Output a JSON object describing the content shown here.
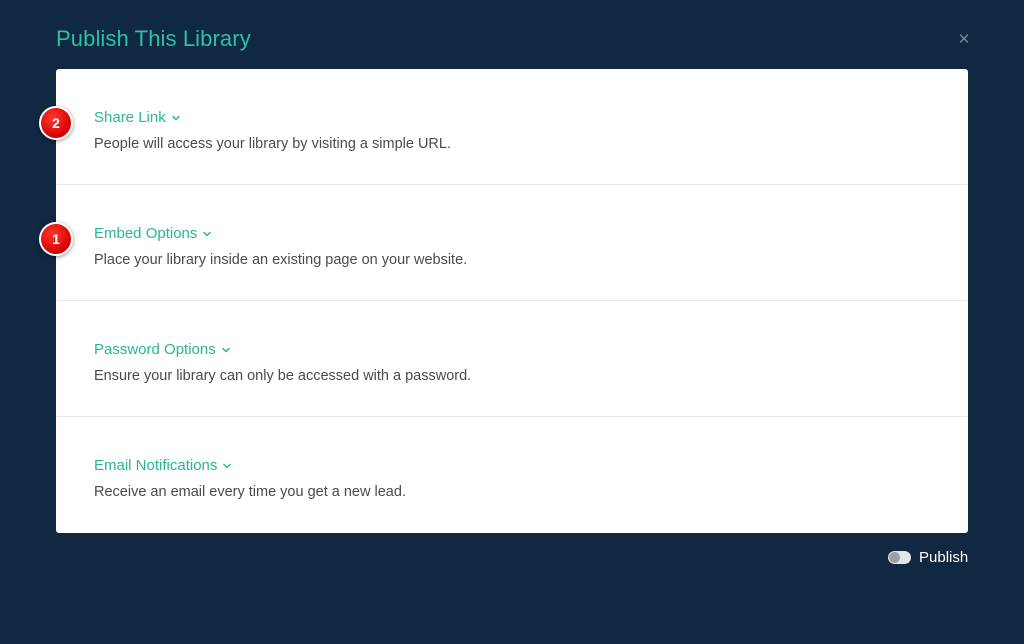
{
  "modal": {
    "title": "Publish This Library",
    "close_icon": "close-icon"
  },
  "sections": [
    {
      "title": "Share Link",
      "description": "People will access your library by visiting a simple URL.",
      "badge": "2"
    },
    {
      "title": "Embed Options",
      "description": "Place your library inside an existing page on your website.",
      "badge": "1"
    },
    {
      "title": "Password Options",
      "description": "Ensure your library can only be accessed with a password."
    },
    {
      "title": "Email Notifications",
      "description": "Receive an email every time you get a new lead."
    }
  ],
  "footer": {
    "publish_label": "Publish",
    "publish_enabled": false
  },
  "colors": {
    "background": "#112842",
    "accent": "#2bc1a1",
    "badge": "#e60000"
  }
}
